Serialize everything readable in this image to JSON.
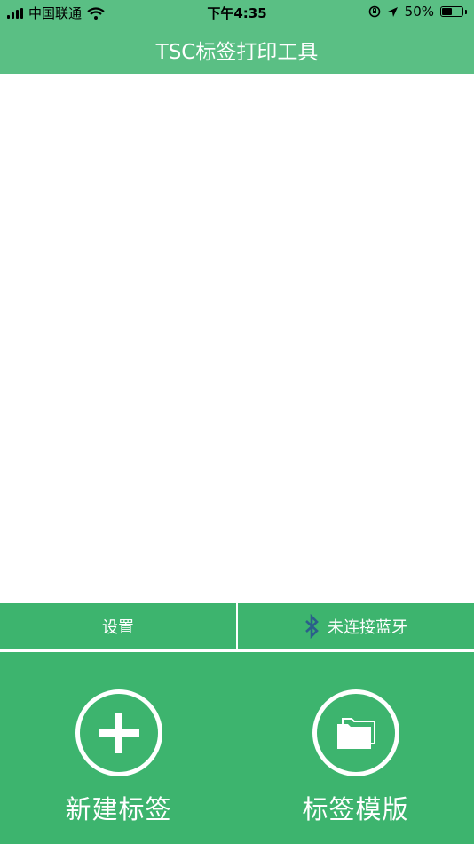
{
  "status": {
    "carrier": "中国联通",
    "time": "下午4:35",
    "battery": "50%",
    "battery_level": 0.5
  },
  "nav": {
    "title": "TSC标签打印工具"
  },
  "actions": {
    "settings_label": "设置",
    "bluetooth_label": "未连接蓝牙"
  },
  "main": {
    "new_label": "新建标签",
    "templates_label": "标签模版"
  },
  "colors": {
    "header_green": "#5abf84",
    "panel_green": "#3db46e",
    "bluetooth_icon": "#2b5f8a"
  }
}
